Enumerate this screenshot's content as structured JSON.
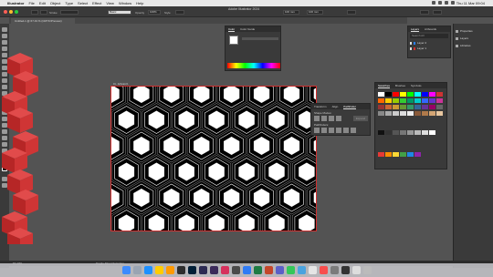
{
  "menubar": {
    "app_name": "Illustrator",
    "menus": [
      "File",
      "Edit",
      "Object",
      "Type",
      "Select",
      "Effect",
      "View",
      "Window",
      "Help"
    ],
    "clock": "Thu 11 Mar  09:04"
  },
  "window": {
    "title": "Adobe Illustrator 2024"
  },
  "control_bar": {
    "selection": "No Selection",
    "stroke_label": "Stroke",
    "style_field": "Basic",
    "opacity_label": "Opacity",
    "opacity_value": "100%",
    "style_label": "Style",
    "width_value": "100 mm",
    "height_value": "100 mm"
  },
  "document_tab": {
    "label": "Untitled-1 @ 67.43 % (CMYK/Preview)"
  },
  "artboard": {
    "label": "01 - Artboard 1"
  },
  "color_panel": {
    "tabs": [
      "Color",
      "Color Guide"
    ]
  },
  "pathfinder_panel": {
    "tabs": [
      "Transform",
      "Align",
      "Pathfinder"
    ],
    "shape_modes_label": "Shape Modes:",
    "pathfinders_label": "Pathfinders:",
    "expand_label": "Expand"
  },
  "swatches_panel": {
    "tabs": [
      "Swatches",
      "Brushes",
      "Symbols"
    ]
  },
  "layers_panel": {
    "tabs": [
      "Layers",
      "Artboards"
    ],
    "search_value": "Search All",
    "layers": [
      "Layer 2",
      "Layer 1"
    ]
  },
  "right_dock": {
    "items": [
      "Properties",
      "Layers",
      "Libraries"
    ]
  },
  "status_bar": {
    "zoom": "67.43%",
    "tool_status": "Toggle Direct Selection"
  },
  "colors": {
    "accent_red": "#d12f2f",
    "pattern_white": "#ffffff",
    "panel_bg": "#3a3a3a"
  }
}
